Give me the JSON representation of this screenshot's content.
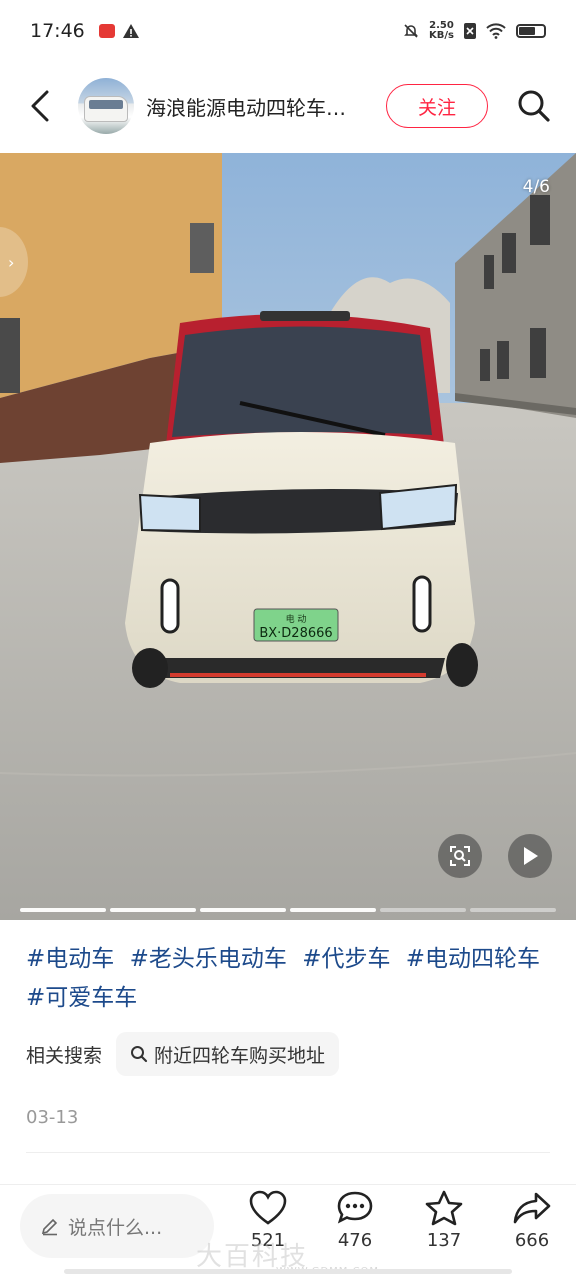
{
  "status_bar": {
    "time": "17:46",
    "net_speed_value": "2.50",
    "net_speed_unit": "KB/s"
  },
  "header": {
    "author_name": "海浪能源电动四轮车…",
    "follow_label": "关注"
  },
  "media": {
    "counter": "4/6",
    "slides_total": 6,
    "slide_active": 4,
    "plate_text": "BX·D28666",
    "plate_top": "电 动"
  },
  "tags": [
    "#电动车",
    "#老头乐电动车",
    "#代步车",
    "#电动四轮车",
    "#可爱车车"
  ],
  "related": {
    "label": "相关搜索",
    "query": "附近四轮车购买地址"
  },
  "post_date": "03-13",
  "bottom_bar": {
    "comment_placeholder": "说点什么...",
    "likes": "521",
    "comments": "476",
    "favorites": "137",
    "shares": "666"
  },
  "watermark": {
    "text": "大百科技",
    "url": "WWW.GDMM.COM"
  },
  "colors": {
    "accent": "#ff2442",
    "tag_blue": "#1d4a8b"
  }
}
